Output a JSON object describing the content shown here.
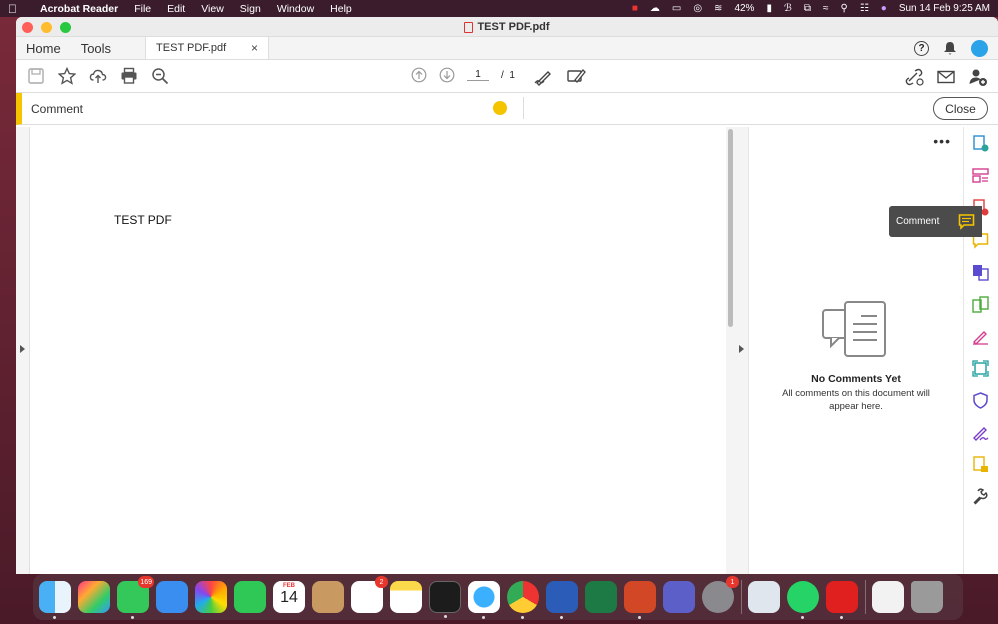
{
  "menubar": {
    "app_name": "Acrobat Reader",
    "menus": [
      "File",
      "Edit",
      "View",
      "Sign",
      "Window",
      "Help"
    ],
    "battery": "42%",
    "datetime": "Sun 14 Feb  9:25 AM"
  },
  "window": {
    "title": "TEST PDF.pdf"
  },
  "tabs": {
    "home": "Home",
    "tools": "Tools",
    "doc": "TEST PDF.pdf",
    "close": "×"
  },
  "toolbar": {
    "page_current": "1",
    "page_sep": "/",
    "page_total": "1"
  },
  "comment_bar": {
    "label": "Comment",
    "close_label": "Close",
    "color": "#f5c400"
  },
  "document": {
    "text": "TEST PDF"
  },
  "panel": {
    "more": "•••",
    "empty_title": "No Comments Yet",
    "empty_subtitle": "All comments on this document will appear here."
  },
  "rail": {
    "tooltip": "Comment",
    "icons": [
      "export-pdf-icon",
      "organize-pages-icon",
      "create-pdf-icon",
      "comment-icon",
      "combine-files-icon",
      "edit-pdf-icon",
      "fill-sign-icon",
      "scan-ocr-icon",
      "protect-icon",
      "request-signature-icon",
      "compress-icon",
      "more-tools-icon"
    ]
  },
  "dock": {
    "messages_badge": "169",
    "reminders_badge": "2",
    "settings_badge": "1",
    "calendar_month": "FEB",
    "calendar_day": "14"
  }
}
